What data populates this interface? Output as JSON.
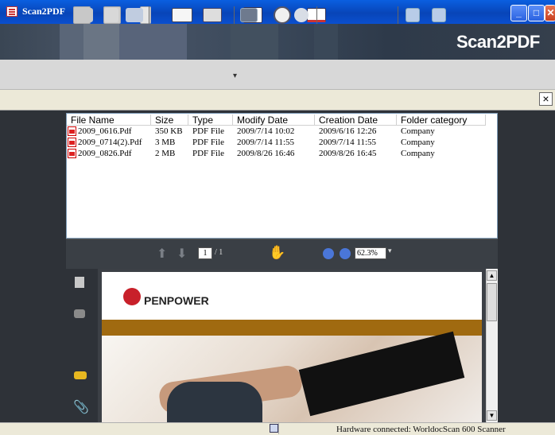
{
  "window": {
    "title": "Scan2PDF"
  },
  "banner": {
    "logo_text": "Scan2PDF"
  },
  "toolbar": {
    "icons": [
      "scan-icon",
      "batch-scan-icon",
      "convert-icon",
      "email-icon",
      "view-mode-icon",
      "preview-icon",
      "search-icon",
      "note-icon"
    ]
  },
  "filelist": {
    "columns": [
      "File Name",
      "Size",
      "Type",
      "Modify Date",
      "Creation Date",
      "Folder category"
    ],
    "rows": [
      {
        "name": "2009_0616.Pdf",
        "size": "350 KB",
        "type": "PDF File",
        "modified": "2009/7/14 10:02",
        "created": "2009/6/16 12:26",
        "folder": "Company"
      },
      {
        "name": "2009_0714(2).Pdf",
        "size": "3 MB",
        "type": "PDF File",
        "modified": "2009/7/14 11:55",
        "created": "2009/7/14 11:55",
        "folder": "Company"
      },
      {
        "name": "2009_0826.Pdf",
        "size": "2 MB",
        "type": "PDF File",
        "modified": "2009/8/26 16:46",
        "created": "2009/8/26 16:45",
        "folder": "Company"
      }
    ]
  },
  "viewer": {
    "page_current": "1",
    "page_total": "/ 1",
    "zoom": "62.3%"
  },
  "document": {
    "brand": "PENPOWER"
  },
  "status": {
    "text": "Hardware connected: WorldocScan 600 Scanner"
  },
  "colors": {
    "title_bar": "#0845b8",
    "accent_gold": "#a06a10",
    "penpower_red": "#c8202a"
  }
}
